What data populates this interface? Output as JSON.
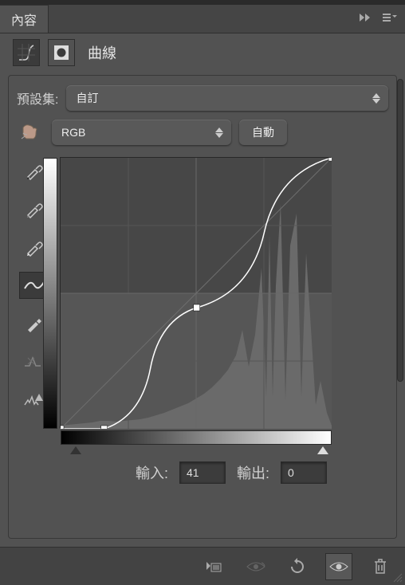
{
  "panel": {
    "tab_title": "內容",
    "adjustment_name": "曲線"
  },
  "preset": {
    "label": "預設集:",
    "value": "自訂"
  },
  "channel": {
    "value": "RGB",
    "auto_label": "自動"
  },
  "io": {
    "input_label": "輸入:",
    "input_value": "41",
    "output_label": "輸出:",
    "output_value": "0"
  },
  "chart_data": {
    "type": "line",
    "title": "曲線",
    "xlabel": "輸入",
    "ylabel": "輸出",
    "xlim": [
      0,
      255
    ],
    "ylim": [
      0,
      255
    ],
    "series": [
      {
        "name": "curve",
        "points": [
          {
            "x": 0,
            "y": 0
          },
          {
            "x": 41,
            "y": 0
          },
          {
            "x": 128,
            "y": 114
          },
          {
            "x": 255,
            "y": 255
          }
        ]
      }
    ],
    "histogram_silhouette": "0,340 0,336 10,335 20,334 30,333 40,332 50,330 60,330 70,331 80,330 90,329 100,328 110,326 120,323 130,320 140,316 150,312 160,308 170,302 180,296 190,288 200,278 210,266 220,248 228,216 236,262 244,222 252,138 258,300 262,96 266,300 270,160 276,58 282,304 288,110 296,70 302,300 308,120 314,214 320,310 326,280 334,320 340,336 340,340"
  },
  "icons": {
    "curves_tab": "curves-icon",
    "mask": "mask-icon",
    "finger": "finger-icon",
    "eyedrop_black": "eyedropper-black-icon",
    "eyedrop_gray": "eyedropper-gray-icon",
    "eyedrop_white": "eyedropper-white-icon",
    "edit_points": "edit-points-icon",
    "pencil": "pencil-icon",
    "smooth": "smooth-icon",
    "clip": "clip-warning-icon",
    "clip_to_layer": "clip-to-layer-icon",
    "view_prev": "view-previous-icon",
    "reset": "reset-icon",
    "visibility": "visibility-icon",
    "trash": "trash-icon",
    "skip": "skip-icon",
    "menu": "panel-menu-icon"
  },
  "colors": {
    "panel_bg": "#525252",
    "dark_bg": "#3b3b3b",
    "text": "#e0e0e0"
  }
}
